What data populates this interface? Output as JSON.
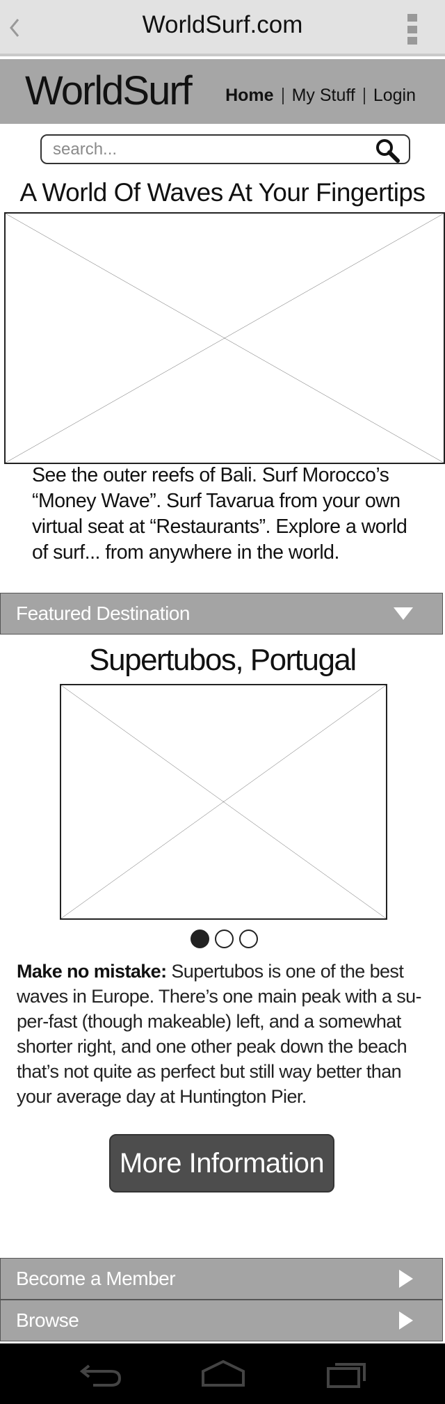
{
  "browser": {
    "url": "WorldSurf.com"
  },
  "site": {
    "logo": "WorldSurf",
    "nav": [
      {
        "label": "Home",
        "active": true
      },
      {
        "label": "My Stuff",
        "active": false
      },
      {
        "label": "Login",
        "active": false
      }
    ]
  },
  "search": {
    "placeholder": "search..."
  },
  "hero": {
    "title": "A World Of Waves At Your Fingertips",
    "intro": "See the outer reefs of Bali. Surf Morocco’s “Money Wave”. Surf Tavarua from your own virtual seat at “Restaurants”. Explore a world of surf... from anywhere in the world."
  },
  "featured": {
    "header": "Featured Destination",
    "destination": "Supertubos, Portugal",
    "carousel": {
      "count": 3,
      "active_index": 0
    },
    "description_lead": "Make no mistake:",
    "description_body": " Supertubos is one of the best waves in Europe. There’s one main peak with a su-per-fast (though makeable) left, and a somewhat shorter right, and one other peak down the beach that’s not quite as perfect but still way better than your average day at Huntington Pier.",
    "cta_label": "More Information"
  },
  "bottom_sections": [
    {
      "label": "Become a Member"
    },
    {
      "label": "Browse"
    }
  ],
  "colors": {
    "header_bg": "#a6a6a6",
    "accordion_bg": "#a4a4a4",
    "cta_bg": "#4d4d4d",
    "browser_bar_bg": "#e2e2e2",
    "system_nav_bg": "#000000"
  },
  "icons": {
    "back": "chevron-left-icon",
    "overflow": "overflow-menu-icon",
    "search": "search-icon",
    "system_back": "back-icon",
    "system_home": "home-icon",
    "system_recents": "recents-icon"
  }
}
